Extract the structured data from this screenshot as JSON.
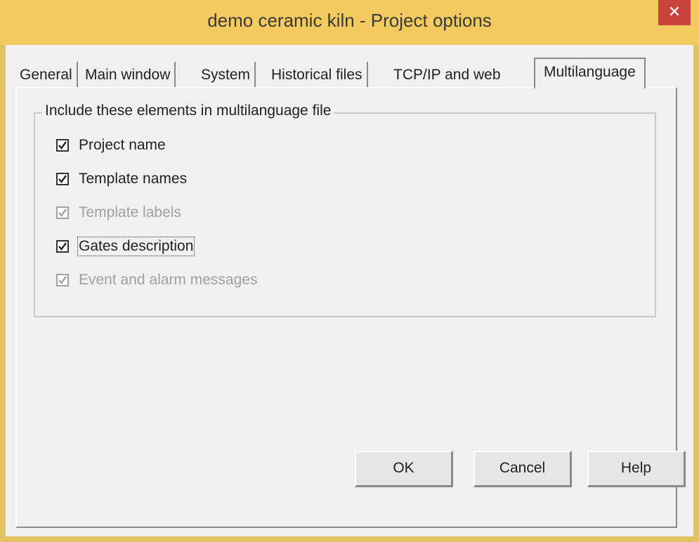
{
  "window": {
    "title": "demo ceramic kiln - Project options",
    "close_glyph": "✕"
  },
  "tabs": [
    {
      "label": "General"
    },
    {
      "label": "Main window"
    },
    {
      "label": "System"
    },
    {
      "label": "Historical files"
    },
    {
      "label": "TCP/IP and web"
    },
    {
      "label": "Multilanguage",
      "active": true
    }
  ],
  "group": {
    "label": "Include these elements in multilanguage file",
    "items": [
      {
        "label": "Project name",
        "checked": true,
        "enabled": true
      },
      {
        "label": "Template names",
        "checked": true,
        "enabled": true
      },
      {
        "label": "Template labels",
        "checked": true,
        "enabled": false
      },
      {
        "label": "Gates description",
        "checked": true,
        "enabled": true,
        "focused": true
      },
      {
        "label": "Event and alarm messages",
        "checked": true,
        "enabled": false
      }
    ]
  },
  "buttons": {
    "ok": "OK",
    "cancel": "Cancel",
    "help": "Help"
  },
  "colors": {
    "titlebar": "#f2ca5e",
    "close_button": "#c7433c",
    "dialog_background": "#f0f0f0",
    "disabled_text": "#a0a0a0"
  },
  "icons": {
    "close": "close-icon",
    "checkmark": "checkmark-icon"
  }
}
